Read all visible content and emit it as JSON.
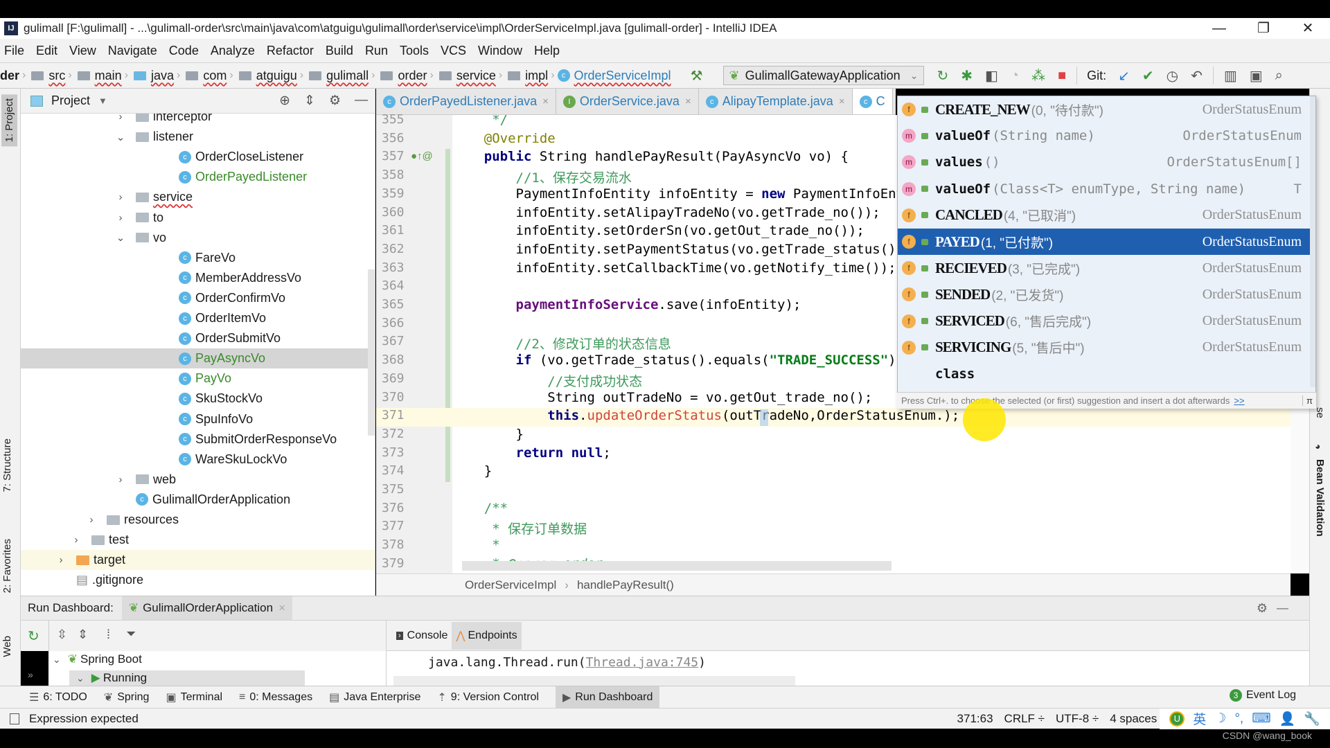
{
  "window": {
    "title": "gulimall [F:\\gulimall] - ...\\gulimall-order\\src\\main\\java\\com\\atguigu\\gulimall\\order\\service\\impl\\OrderServiceImpl.java [gulimall-order] - IntelliJ IDEA",
    "app_icon": "IJ",
    "minimize": "—",
    "restore": "❐",
    "close": "✕"
  },
  "menu": [
    "File",
    "Edit",
    "View",
    "Navigate",
    "Code",
    "Analyze",
    "Refactor",
    "Build",
    "Run",
    "Tools",
    "VCS",
    "Window",
    "Help"
  ],
  "navbar": {
    "crumbs": [
      {
        "label": "der",
        "folder": false
      },
      {
        "label": "src",
        "folder": true,
        "color": "gray"
      },
      {
        "label": "main",
        "folder": true,
        "color": "gray"
      },
      {
        "label": "java",
        "folder": true,
        "color": "blue"
      },
      {
        "label": "com",
        "folder": true,
        "color": "gray"
      },
      {
        "label": "atguigu",
        "folder": true,
        "color": "gray"
      },
      {
        "label": "gulimall",
        "folder": true,
        "color": "gray"
      },
      {
        "label": "order",
        "folder": true,
        "color": "gray"
      },
      {
        "label": "service",
        "folder": true,
        "color": "gray"
      },
      {
        "label": "impl",
        "folder": true,
        "color": "gray"
      }
    ],
    "current_class": "OrderServiceImpl",
    "run_config": "GulimallGatewayApplication",
    "git_label": "Git:"
  },
  "left_stripe": {
    "project": "1: Project",
    "structure": "7: Structure",
    "favorites": "2: Favorites",
    "web": "Web"
  },
  "project_panel": {
    "title": "Project",
    "tree": [
      {
        "label": "interceptor",
        "type": "folder",
        "indent": 3,
        "expanded": false,
        "partial": true
      },
      {
        "label": "listener",
        "type": "folder",
        "indent": 3,
        "expanded": true
      },
      {
        "label": "OrderCloseListener",
        "type": "class",
        "indent": 4
      },
      {
        "label": "OrderPayedListener",
        "type": "class",
        "indent": 4,
        "modified": true
      },
      {
        "label": "service",
        "type": "folder",
        "indent": 3,
        "expanded": false,
        "error": true
      },
      {
        "label": "to",
        "type": "folder",
        "indent": 3,
        "expanded": false
      },
      {
        "label": "vo",
        "type": "folder",
        "indent": 3,
        "expanded": true
      },
      {
        "label": "FareVo",
        "type": "class",
        "indent": 4
      },
      {
        "label": "MemberAddressVo",
        "type": "class",
        "indent": 4
      },
      {
        "label": "OrderConfirmVo",
        "type": "class",
        "indent": 4
      },
      {
        "label": "OrderItemVo",
        "type": "class",
        "indent": 4
      },
      {
        "label": "OrderSubmitVo",
        "type": "class",
        "indent": 4
      },
      {
        "label": "PayAsyncVo",
        "type": "class",
        "indent": 4,
        "modified": true,
        "selected": true
      },
      {
        "label": "PayVo",
        "type": "class",
        "indent": 4,
        "modified": true
      },
      {
        "label": "SkuStockVo",
        "type": "class",
        "indent": 4
      },
      {
        "label": "SpuInfoVo",
        "type": "class",
        "indent": 4
      },
      {
        "label": "SubmitOrderResponseVo",
        "type": "class",
        "indent": 4
      },
      {
        "label": "WareSkuLockVo",
        "type": "class",
        "indent": 4
      },
      {
        "label": "web",
        "type": "folder",
        "indent": 3,
        "expanded": false
      },
      {
        "label": "GulimallOrderApplication",
        "type": "app",
        "indent": 3
      },
      {
        "label": "resources",
        "type": "resfolder",
        "indent": 1,
        "expanded": false
      },
      {
        "label": "test",
        "type": "folder",
        "indent": 0.5,
        "expanded": false
      },
      {
        "label": "target",
        "type": "orangefolder",
        "indent": 0,
        "expanded": false
      },
      {
        "label": ".gitignore",
        "type": "file",
        "indent": 0
      }
    ]
  },
  "editor": {
    "tabs": [
      {
        "label": "OrderPayedListener.java",
        "icon": "C",
        "close": "×"
      },
      {
        "label": "OrderService.java",
        "icon": "I",
        "close": "×"
      },
      {
        "label": "AlipayTemplate.java",
        "icon": "C",
        "close": "×"
      },
      {
        "label": "C",
        "icon": "C",
        "active": true
      }
    ],
    "lines": [
      {
        "n": "355",
        "html": "     <span class='cm'>*/</span>"
      },
      {
        "n": "356",
        "html": "    <span class='an'>@Override</span>"
      },
      {
        "n": "357",
        "html": "    <span class='kw'>public</span> String handlePayResult(PayAsyncVo vo) {"
      },
      {
        "n": "358",
        "html": "        <span class='cm'>//1、保存交易流水</span>"
      },
      {
        "n": "359",
        "html": "        PaymentInfoEntity infoEntity = <span class='kw'>new</span> PaymentInfoEntity();"
      },
      {
        "n": "360",
        "html": "        infoEntity.setAlipayTradeNo(vo.getTrade_no());"
      },
      {
        "n": "361",
        "html": "        infoEntity.setOrderSn(vo.getOut_trade_no());"
      },
      {
        "n": "362",
        "html": "        infoEntity.setPaymentStatus(vo.getTrade_status());"
      },
      {
        "n": "363",
        "html": "        infoEntity.setCallbackTime(vo.getNotify_time());"
      },
      {
        "n": "364",
        "html": ""
      },
      {
        "n": "365",
        "html": "        <span class='fld'>paymentInfoService</span>.save(infoEntity);"
      },
      {
        "n": "366",
        "html": ""
      },
      {
        "n": "367",
        "html": "        <span class='cm'>//2、修改订单的状态信息</span>"
      },
      {
        "n": "368",
        "html": "        <span class='kw'>if</span> (vo.getTrade_status().equals(<span class='str'>\"TRADE_SUCCESS\"</span>)"
      },
      {
        "n": "369",
        "html": "            <span class='cm'>//支付成功状态</span>"
      },
      {
        "n": "370",
        "html": "            String outTradeNo = vo.getOut_trade_no();"
      },
      {
        "n": "371",
        "html": "            <span class='kw'>this</span>.<span class='mcall'>updateOrderStatus</span>(outTradeNo,OrderStatusEnum.);"
      },
      {
        "n": "372",
        "html": "        }"
      },
      {
        "n": "373",
        "html": "        <span class='kw'>return null</span>;"
      },
      {
        "n": "374",
        "html": "    }"
      },
      {
        "n": "375",
        "html": ""
      },
      {
        "n": "376",
        "html": "    <span class='cm'>/**</span>"
      },
      {
        "n": "377",
        "html": "     <span class='cm'>* 保存订单数据</span>"
      },
      {
        "n": "378",
        "html": "     <span class='cm'>*</span>"
      },
      {
        "n": "379",
        "html": "     <span class='cm'>* <b><i>@param</i></b> <i>order</i></span>"
      }
    ],
    "current_line": "371",
    "footer_crumbs": [
      "OrderServiceImpl",
      "handlePayResult()"
    ],
    "footer_sep": "›"
  },
  "completion": {
    "items": [
      {
        "badge": "f",
        "name": "CREATE_NEW",
        "args": "(0, \"待付款\")",
        "type": "OrderStatusEnum",
        "enum": true
      },
      {
        "badge": "m",
        "name": "valueOf",
        "args": "(String name)",
        "type": "OrderStatusEnum",
        "enum": false
      },
      {
        "badge": "m",
        "name": "values",
        "args": "()",
        "type": "OrderStatusEnum[]",
        "enum": false
      },
      {
        "badge": "m",
        "name": "valueOf",
        "args": "(Class<T> enumType, String name)",
        "type": "T",
        "enum": false
      },
      {
        "badge": "f",
        "name": "CANCLED",
        "args": "(4, \"已取消\")",
        "type": "OrderStatusEnum",
        "enum": true
      },
      {
        "badge": "f",
        "name": "PAYED",
        "args": "(1, \"已付款\")",
        "type": "OrderStatusEnum",
        "enum": true,
        "selected": true
      },
      {
        "badge": "f",
        "name": "RECIEVED",
        "args": "(3, \"已完成\")",
        "type": "OrderStatusEnum",
        "enum": true
      },
      {
        "badge": "f",
        "name": "SENDED",
        "args": "(2, \"已发货\")",
        "type": "OrderStatusEnum",
        "enum": true
      },
      {
        "badge": "f",
        "name": "SERVICED",
        "args": "(6, \"售后完成\")",
        "type": "OrderStatusEnum",
        "enum": true
      },
      {
        "badge": "f",
        "name": "SERVICING",
        "args": "(5, \"售后中\")",
        "type": "OrderStatusEnum",
        "enum": true
      },
      {
        "badge": "",
        "name": "class",
        "args": "",
        "type": "",
        "enum": false
      }
    ],
    "hint": "Press Ctrl+. to choose the selected (or first) suggestion and insert a dot afterwards",
    "hint_more": ">>",
    "pi_button": "π"
  },
  "right_stripe": {
    "bean_validation": "Bean Validation",
    "partial": "se"
  },
  "run_dashboard": {
    "label": "Run Dashboard:",
    "tab": "GulimallOrderApplication",
    "tab_close": "×",
    "tree": [
      {
        "label": "Spring Boot",
        "expanded": true
      },
      {
        "label": "Running",
        "expanded": true
      }
    ],
    "console_tabs": [
      "Console",
      "Endpoints"
    ],
    "console_line_prefix": "java.lang.Thread.run(",
    "console_link": "Thread.java:745",
    "console_line_suffix": ")"
  },
  "tool_tabs": [
    {
      "label": "6: TODO",
      "icon": "☰"
    },
    {
      "label": "Spring",
      "icon": "❦"
    },
    {
      "label": "Terminal",
      "icon": "▣"
    },
    {
      "label": "0: Messages",
      "icon": "≡"
    },
    {
      "label": "Java Enterprise",
      "icon": "▤"
    },
    {
      "label": "9: Version Control",
      "icon": "⇡"
    },
    {
      "label": "Run Dashboard",
      "icon": "▶",
      "active": true
    }
  ],
  "event_log": {
    "label": "Event Log",
    "count": "3"
  },
  "status": {
    "message": "Expression expected",
    "position": "371:63",
    "line_sep": "CRLF ÷",
    "encoding": "UTF-8 ÷",
    "indent": "4 spaces",
    "ime": [
      "U",
      "英",
      "☽",
      "°,",
      "⌨",
      "👤",
      "🔧"
    ]
  },
  "watermark": "CSDN @wang_book"
}
